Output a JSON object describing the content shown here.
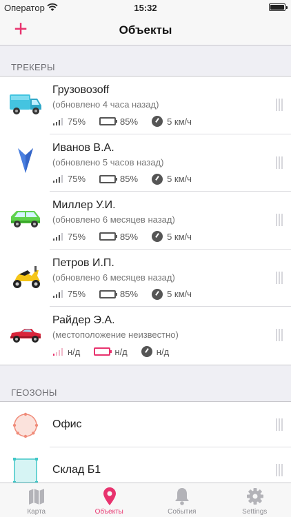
{
  "status_bar": {
    "carrier": "Оператор",
    "time": "15:32"
  },
  "nav": {
    "title": "Объекты",
    "add_label": "+"
  },
  "sections": {
    "trackers_title": "ТРЕКЕРЫ",
    "geozones_title": "ГЕОЗОНЫ"
  },
  "trackers": [
    {
      "name": "Грузовозоff",
      "status": "(обновлено 4 часа назад)",
      "signal": "75%",
      "battery": "85%",
      "speed": "5 км/ч",
      "icon": "truck-icon"
    },
    {
      "name": "Иванов В.А.",
      "status": "(обновлено 5 часов назад)",
      "signal": "75%",
      "battery": "85%",
      "speed": "5 км/ч",
      "icon": "arrow-marker-icon"
    },
    {
      "name": "Миллер У.И.",
      "status": "(обновлено 6 месяцев назад)",
      "signal": "75%",
      "battery": "85%",
      "speed": "5 км/ч",
      "icon": "minivan-icon"
    },
    {
      "name": "Петров И.П.",
      "status": "(обновлено 6 месяцев назад)",
      "signal": "75%",
      "battery": "85%",
      "speed": "5 км/ч",
      "icon": "scooter-icon"
    },
    {
      "name": "Райдер Э.А.",
      "status": "(местоположение неизвестно)",
      "signal": "н/д",
      "battery": "н/д",
      "speed": "н/д",
      "icon": "convertible-car-icon"
    }
  ],
  "geozones": [
    {
      "name": "Офис",
      "icon": "circle-zone-icon",
      "color": "#f08c7a"
    },
    {
      "name": "Склад Б1",
      "icon": "square-zone-icon",
      "color": "#41c7c7"
    }
  ],
  "tabs": [
    {
      "label": "Карта",
      "icon": "map-icon",
      "active": false
    },
    {
      "label": "Объекты",
      "icon": "location-pin-icon",
      "active": true
    },
    {
      "label": "События",
      "icon": "bell-icon",
      "active": false
    },
    {
      "label": "Settings",
      "icon": "gear-icon",
      "active": false
    }
  ],
  "colors": {
    "accent": "#e8336e",
    "grey_icon": "#b3b3b8",
    "alert": "#e8336e"
  }
}
